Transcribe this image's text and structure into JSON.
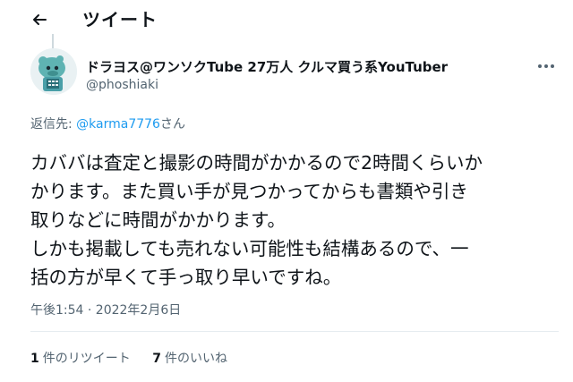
{
  "header": {
    "back_icon": "arrow-left-icon",
    "title": "ツイート"
  },
  "author": {
    "display_name": "ドラヨス@ワンソクTube 27万人 クルマ買う系YouTuber",
    "handle": "@phoshiaki",
    "avatar_icon": "avatar-character-icon",
    "more_icon": "more-dots-icon"
  },
  "reply": {
    "prefix": "返信先: ",
    "mention": "@karma7776",
    "suffix": "さん"
  },
  "tweet": {
    "lines": [
      "カババは査定と撮影の時間がかかるので2時間くらいか",
      "かります。また買い手が見つかってからも書類や引き",
      "取りなどに時間がかかります。",
      "しかも掲載しても売れない可能性も結構あるので、一",
      "括の方が早くて手っ取り早いですね。"
    ],
    "timestamp": "午後1:54 · 2022年2月6日"
  },
  "stats": {
    "retweets_count": "1",
    "retweets_label": "件のリツイート",
    "likes_count": "7",
    "likes_label": "件のいいね"
  },
  "colors": {
    "accent": "#1d9bf0",
    "text": "#0f1419",
    "muted": "#536471",
    "divider": "#e6ecf0"
  }
}
